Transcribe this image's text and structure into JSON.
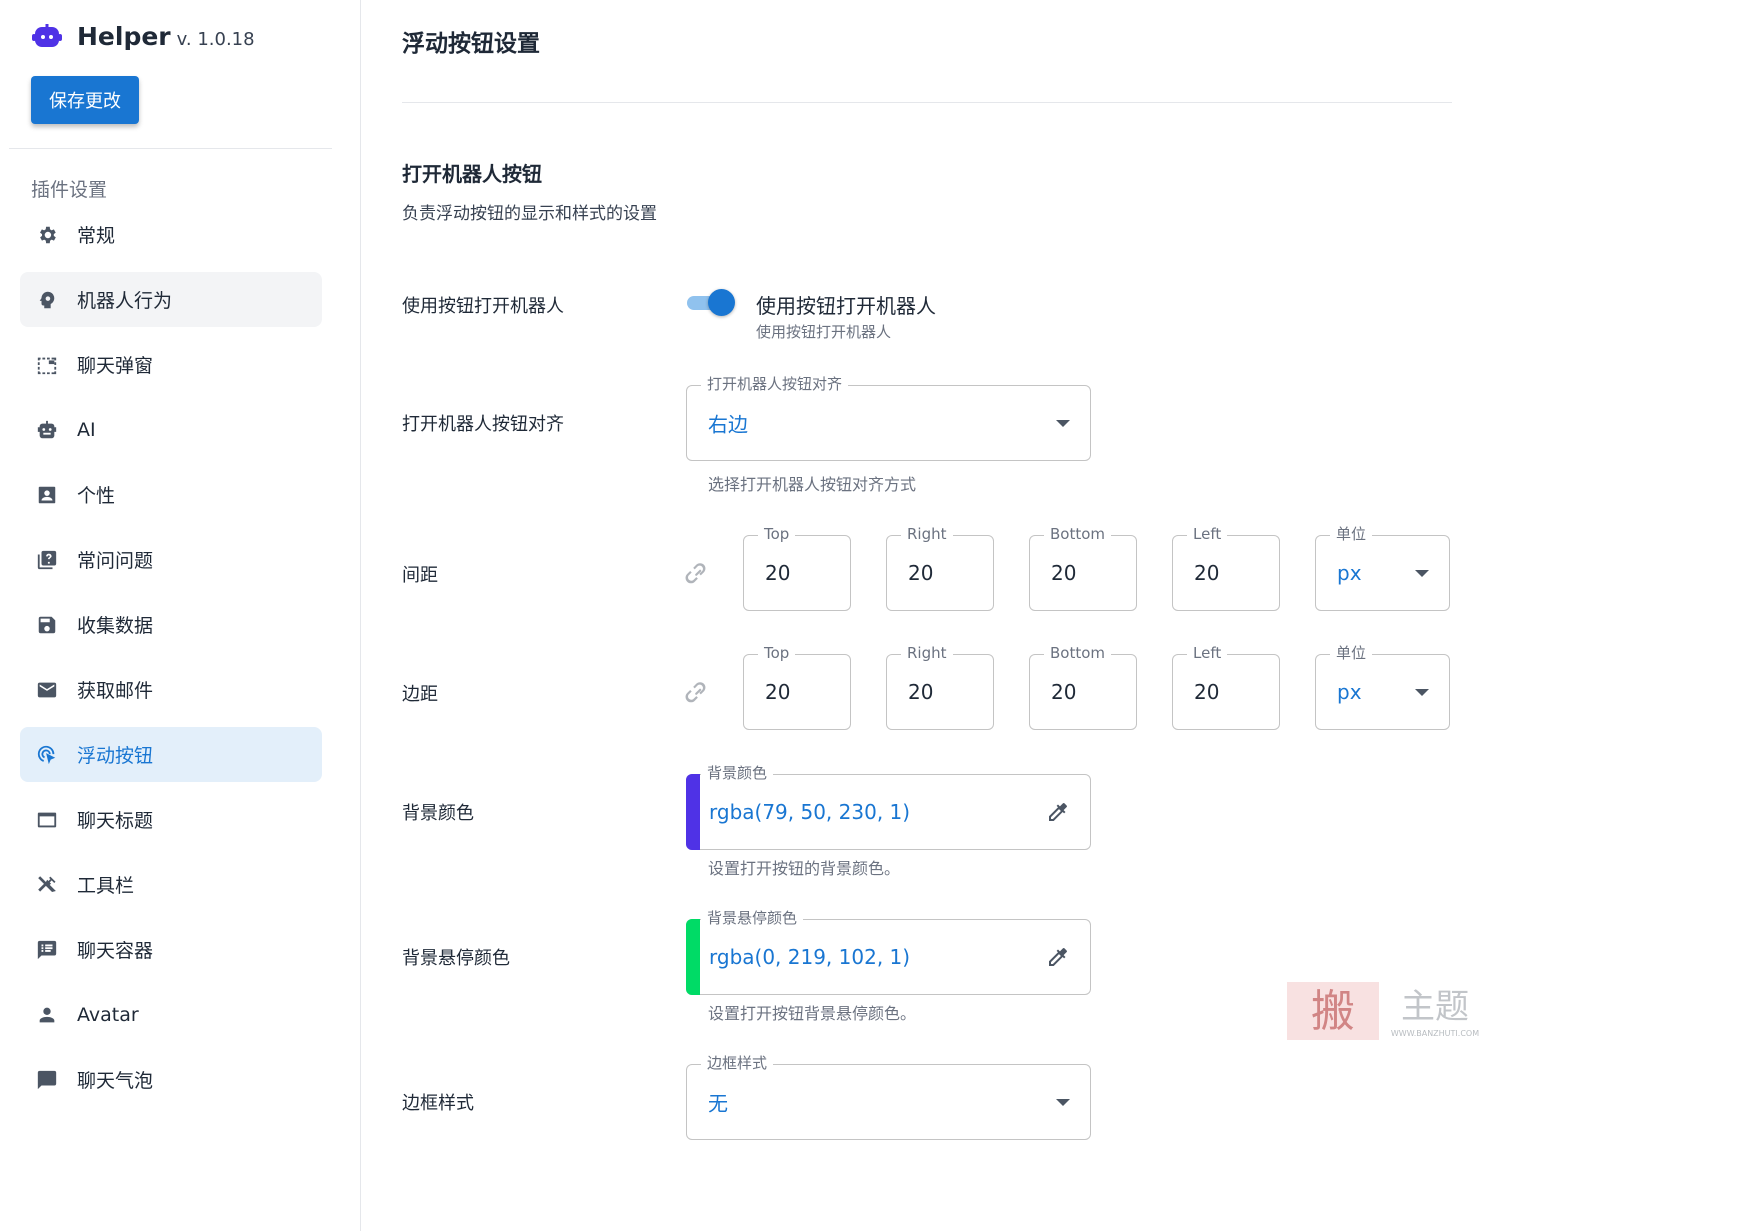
{
  "brand": {
    "name": "Helper",
    "version": "v. 1.0.18",
    "logo_icon": "robot-logo-icon",
    "logo_color": "#4f32e6"
  },
  "save_button": {
    "label": "保存更改"
  },
  "sidebar": {
    "section_title": "插件设置",
    "items": [
      {
        "label": "常规",
        "icon": "gear-icon"
      },
      {
        "label": "机器人行为",
        "icon": "brain-icon"
      },
      {
        "label": "聊天弹窗",
        "icon": "dashed-window-icon"
      },
      {
        "label": "AI",
        "icon": "robot-icon"
      },
      {
        "label": "个性",
        "icon": "contact-card-icon"
      },
      {
        "label": "常问问题",
        "icon": "quiz-icon"
      },
      {
        "label": "收集数据",
        "icon": "save-disk-icon"
      },
      {
        "label": "获取邮件",
        "icon": "mail-icon"
      },
      {
        "label": "浮动按钮",
        "icon": "cursor-click-icon"
      },
      {
        "label": "聊天标题",
        "icon": "window-icon"
      },
      {
        "label": "工具栏",
        "icon": "tools-icon"
      },
      {
        "label": "聊天容器",
        "icon": "chat-list-icon"
      },
      {
        "label": "Avatar",
        "icon": "person-icon"
      },
      {
        "label": "聊天气泡",
        "icon": "chat-bubble-icon"
      }
    ],
    "hovered_label": "机器人行为",
    "active_label": "浮动按钮"
  },
  "page": {
    "title": "浮动按钮设置"
  },
  "section": {
    "title": "打开机器人按钮",
    "description": "负责浮动按钮的显示和样式的设置"
  },
  "use_button": {
    "label": "使用按钮打开机器人",
    "switch_label": "使用按钮打开机器人",
    "switch_hint": "使用按钮打开机器人",
    "enabled": true
  },
  "alignment": {
    "label": "打开机器人按钮对齐",
    "field_legend": "打开机器人按钮对齐",
    "value": "右边",
    "hint": "选择打开机器人按钮对齐方式"
  },
  "padding": {
    "label": "间距",
    "top_legend": "Top",
    "top": "20",
    "right_legend": "Right",
    "right": "20",
    "bottom_legend": "Bottom",
    "bottom": "20",
    "left_legend": "Left",
    "left": "20",
    "unit_legend": "单位",
    "unit": "px"
  },
  "margin": {
    "label": "边距",
    "top_legend": "Top",
    "top": "20",
    "right_legend": "Right",
    "right": "20",
    "bottom_legend": "Bottom",
    "bottom": "20",
    "left_legend": "Left",
    "left": "20",
    "unit_legend": "单位",
    "unit": "px"
  },
  "bg_color": {
    "label": "背景颜色",
    "field_legend": "背景颜色",
    "value": "rgba(79, 50, 230, 1)",
    "swatch": "#4f32e6",
    "hint": "设置打开按钮的背景颜色。"
  },
  "bg_hover_color": {
    "label": "背景悬停颜色",
    "field_legend": "背景悬停颜色",
    "value": "rgba(0, 219, 102, 1)",
    "swatch": "#00db66",
    "hint": "设置打开按钮背景悬停颜色。"
  },
  "border_style": {
    "label": "边框样式",
    "field_legend": "边框样式",
    "value": "无"
  },
  "watermark": {
    "text": "主题",
    "url": "WWW.BANZHUTI.COM",
    "seal": "搬"
  },
  "colors": {
    "accent": "#1976d2",
    "active_bg": "#e3effa"
  }
}
